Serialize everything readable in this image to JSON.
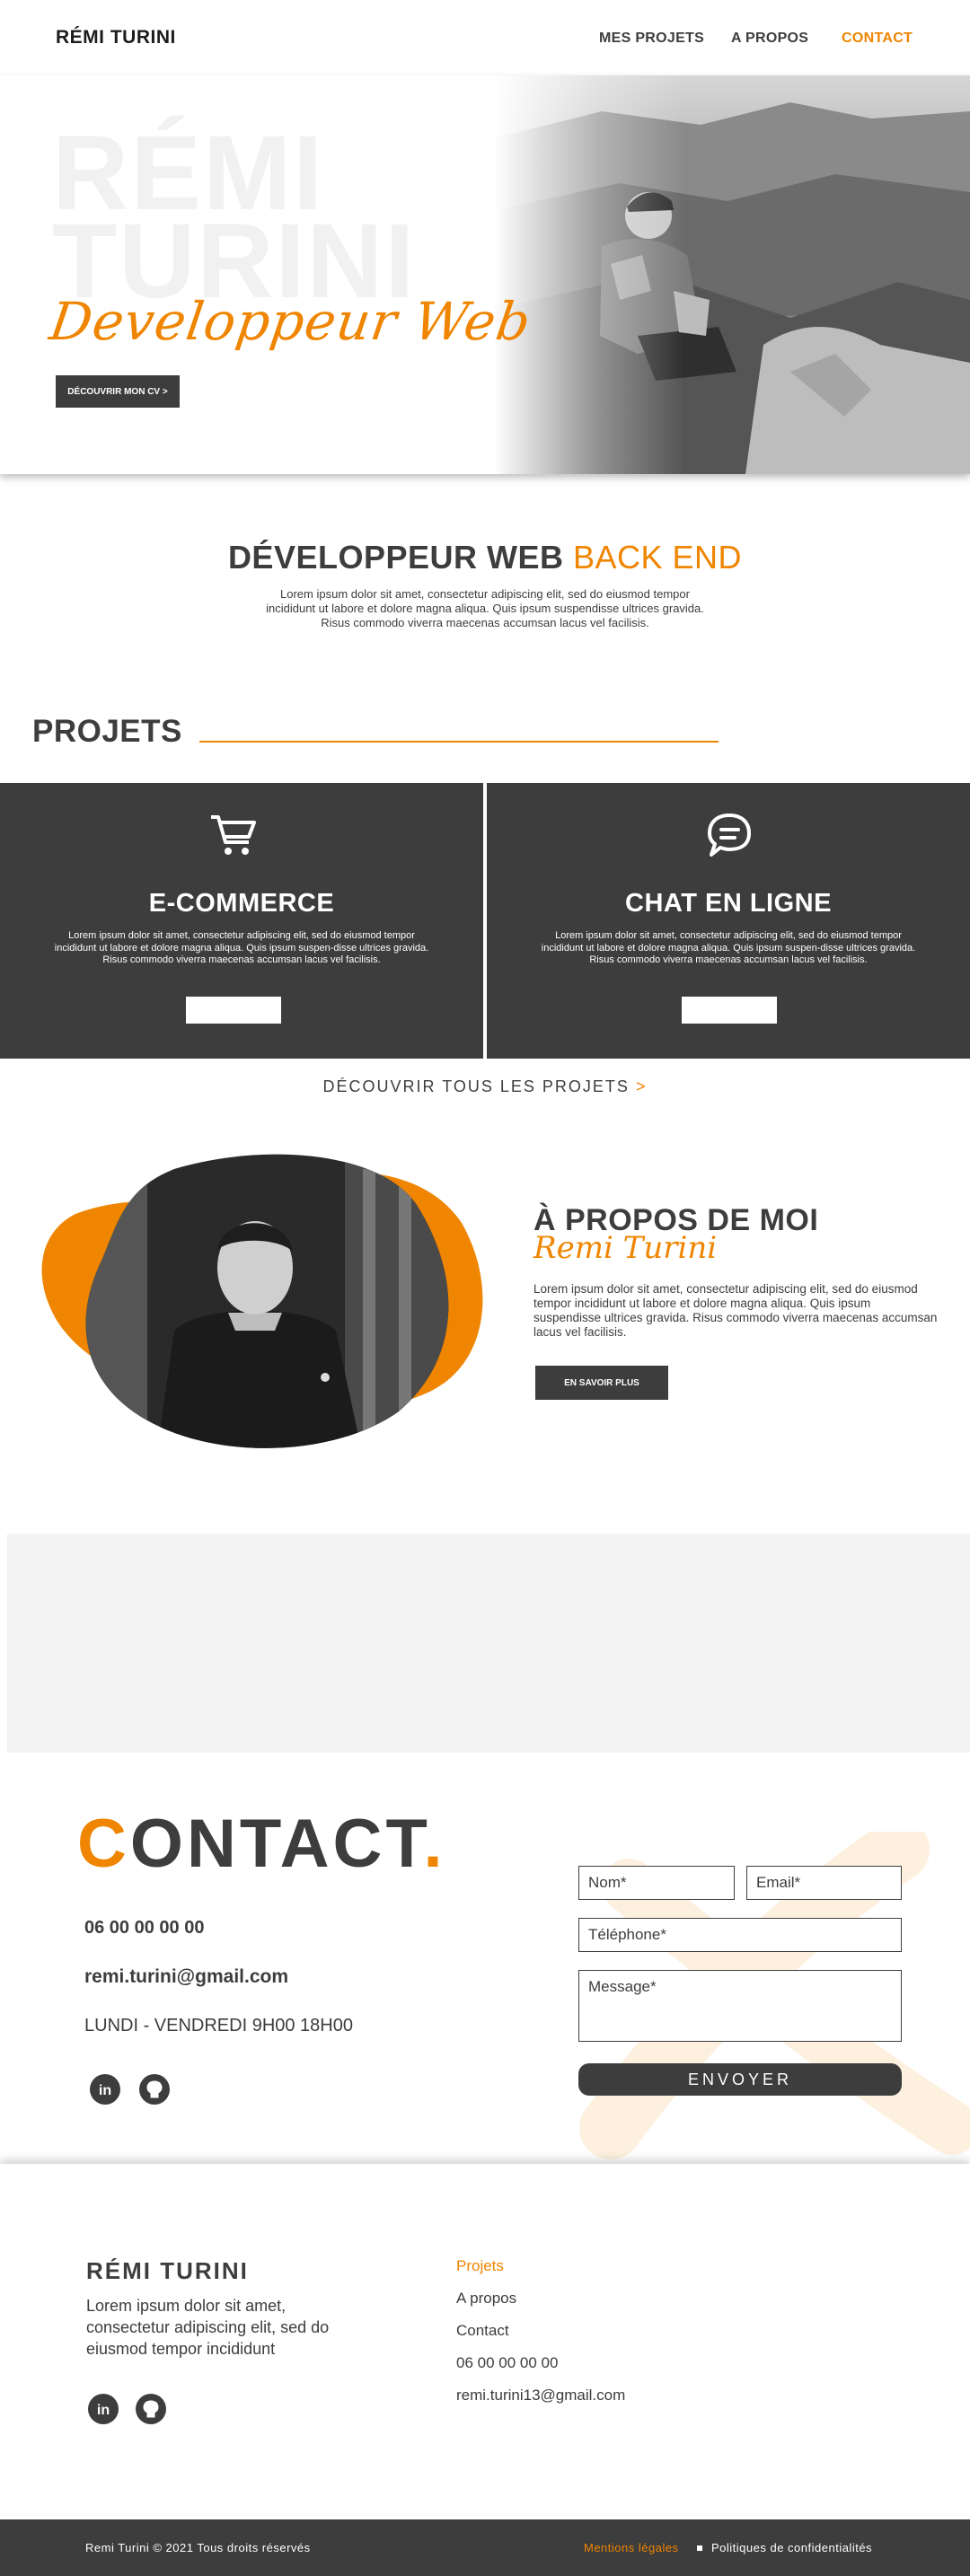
{
  "nav": {
    "brand": "RÉMI TURINI",
    "links": [
      "MES PROJETS",
      "A PROPOS",
      "CONTACT"
    ]
  },
  "hero": {
    "bg_name_1": "RÉMI",
    "bg_name_2": "TURINI",
    "script": "Developpeur Web",
    "cta": "DÉCOUVRIR MON CV >"
  },
  "dev": {
    "title_bold": "DÉVELOPPEUR WEB",
    "title_accent": "BACK END",
    "text": "Lorem ipsum dolor sit amet, consectetur adipiscing elit, sed do eiusmod tempor incididunt ut labore et dolore magna aliqua. Quis ipsum suspendisse ultrices gravida. Risus commodo viverra maecenas accumsan lacus vel facilisis."
  },
  "projects": {
    "title": "PROJETS",
    "cards": [
      {
        "title": "E-COMMERCE",
        "text": "Lorem ipsum dolor sit amet, consectetur adipiscing elit, sed do eiusmod tempor incididunt ut labore et dolore magna aliqua. Quis ipsum suspen-disse ultrices gravida. Risus commodo viverra maecenas accumsan lacus vel facilisis.",
        "icon": "cart-icon"
      },
      {
        "title": "CHAT EN LIGNE",
        "text": "Lorem ipsum dolor sit amet, consectetur adipiscing elit, sed do eiusmod tempor incididunt ut labore et dolore magna aliqua. Quis ipsum suspen-disse ultrices gravida. Risus commodo viverra maecenas accumsan lacus vel facilisis.",
        "icon": "chat-icon"
      }
    ],
    "discover_all": "DÉCOUVRIR TOUS LES PROJETS",
    "discover_arrow": ">"
  },
  "about": {
    "title": "À PROPOS DE MOI",
    "script": "Remi Turini",
    "text": "Lorem ipsum dolor sit amet, consectetur adipiscing elit, sed do eiusmod tempor incididunt ut labore et dolore magna aliqua. Quis ipsum suspendisse ultrices gravida. Risus commodo viverra maecenas accumsan lacus vel facilisis.",
    "cta": "EN SAVOIR PLUS"
  },
  "contact": {
    "title_first": "C",
    "title_rest": "ONTACT",
    "title_dot": ".",
    "phone": "06 00 00 00 00",
    "email": "remi.turini@gmail.com",
    "hours": "LUNDI - VENDREDI 9H00 18H00",
    "form": {
      "name_placeholder": "Nom*",
      "email_placeholder": "Email*",
      "phone_placeholder": "Téléphone*",
      "message_placeholder": "Message*",
      "submit": "ENVOYER"
    }
  },
  "footer": {
    "brand": "RÉMI TURINI",
    "description": "Lorem ipsum dolor sit amet, consectetur adipiscing elit, sed do eiusmod tempor incididunt",
    "links": [
      "Projets",
      "A propos",
      "Contact",
      "06 00 00 00 00",
      "remi.turini13@gmail.com"
    ],
    "copyright": "Remi Turini © 2021 Tous droits réservés",
    "legal": "Mentions légales",
    "privacy": "Politiques de confidentialités"
  },
  "colors": {
    "accent": "#ef8500",
    "dark": "#3d3d3d",
    "light_gray": "#f3f3f3"
  }
}
